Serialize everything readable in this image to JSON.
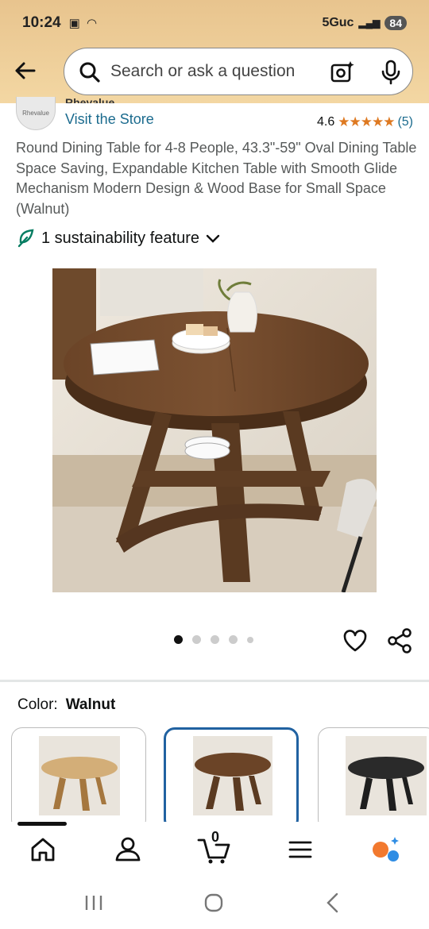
{
  "status_bar": {
    "time": "10:24",
    "network": "5Guc",
    "battery": "84"
  },
  "search": {
    "placeholder": "Search or ask a question"
  },
  "store": {
    "logo_text": "Rhevalue",
    "name": "Rhevalue",
    "link": "Visit the Store"
  },
  "rating": {
    "value": "4.6",
    "stars": "★★★★★",
    "count": "(5)",
    "score": 4.6
  },
  "product": {
    "title": "Round Dining Table for 4-8 People, 43.3\"-59\" Oval Dining Table Space Saving, Expandable Kitchen Table with Smooth Glide Mechanism Modern Design & Wood Base for Small Space (Walnut)",
    "sustainability": "1 sustainability feature"
  },
  "gallery": {
    "image_count": 5,
    "current": 1
  },
  "color": {
    "label": "Color:",
    "selected": "Walnut"
  },
  "swatches": [
    {
      "name": "Natural",
      "top": "#d3ae78",
      "base": "#a5773f"
    },
    {
      "name": "Walnut",
      "top": "#6b4427",
      "base": "#5a3a21"
    },
    {
      "name": "Black",
      "top": "#2a2a2a",
      "base": "#1e1e1e"
    }
  ],
  "cart": {
    "count": "0"
  },
  "colors": {
    "accent": "#2162a1",
    "link": "#1b6b8e",
    "star": "#de7921",
    "header": "#e8c48e"
  }
}
